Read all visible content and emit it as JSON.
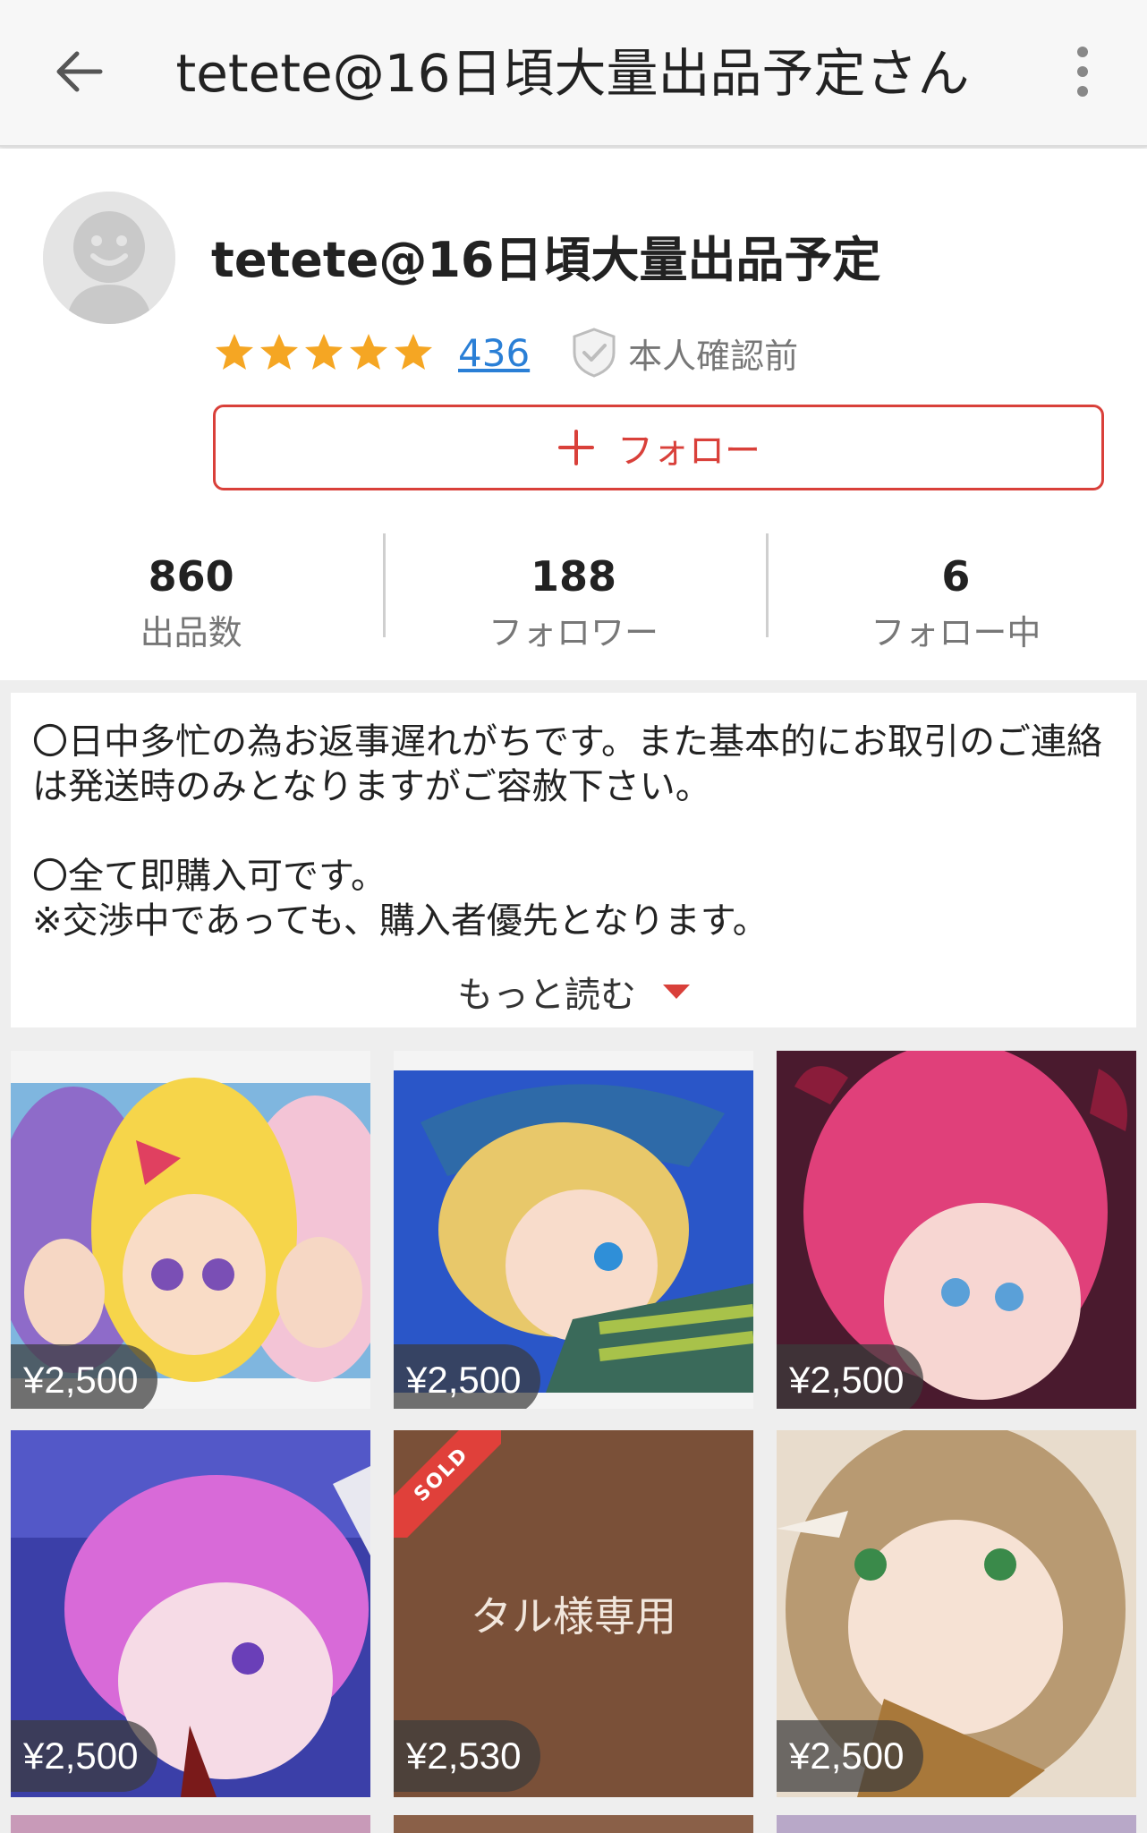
{
  "appbar": {
    "title": "tetete@16日頃大量出品予定さん"
  },
  "profile": {
    "name": "tetete@16日頃大量出品予定",
    "rating_stars": 5,
    "review_count": "436",
    "verification": "本人確認前",
    "follow_label": "フォロー",
    "stats": [
      {
        "value": "860",
        "label": "出品数"
      },
      {
        "value": "188",
        "label": "フォロワー"
      },
      {
        "value": "6",
        "label": "フォロー中"
      }
    ]
  },
  "description": {
    "text": "〇日中多忙の為お返事遅れがちです。また基本的にお取引のご連絡は発送時のみとなりますがご容赦下さい。\n\n〇全て即購入可です。\n※交渉中であっても、購入者優先となります。",
    "read_more": "もっと読む"
  },
  "items": [
    {
      "price": "¥2,500",
      "sold": false
    },
    {
      "price": "¥2,500",
      "sold": false
    },
    {
      "price": "¥2,500",
      "sold": false
    },
    {
      "price": "¥2,500",
      "sold": false
    },
    {
      "price": "¥2,530",
      "sold": true,
      "sold_label": "SOLD",
      "image_text": "タル様専用"
    },
    {
      "price": "¥2,500",
      "sold": false
    }
  ],
  "colors": {
    "accent": "#d9403a",
    "link": "#2a7fd6",
    "star": "#f5a623"
  }
}
